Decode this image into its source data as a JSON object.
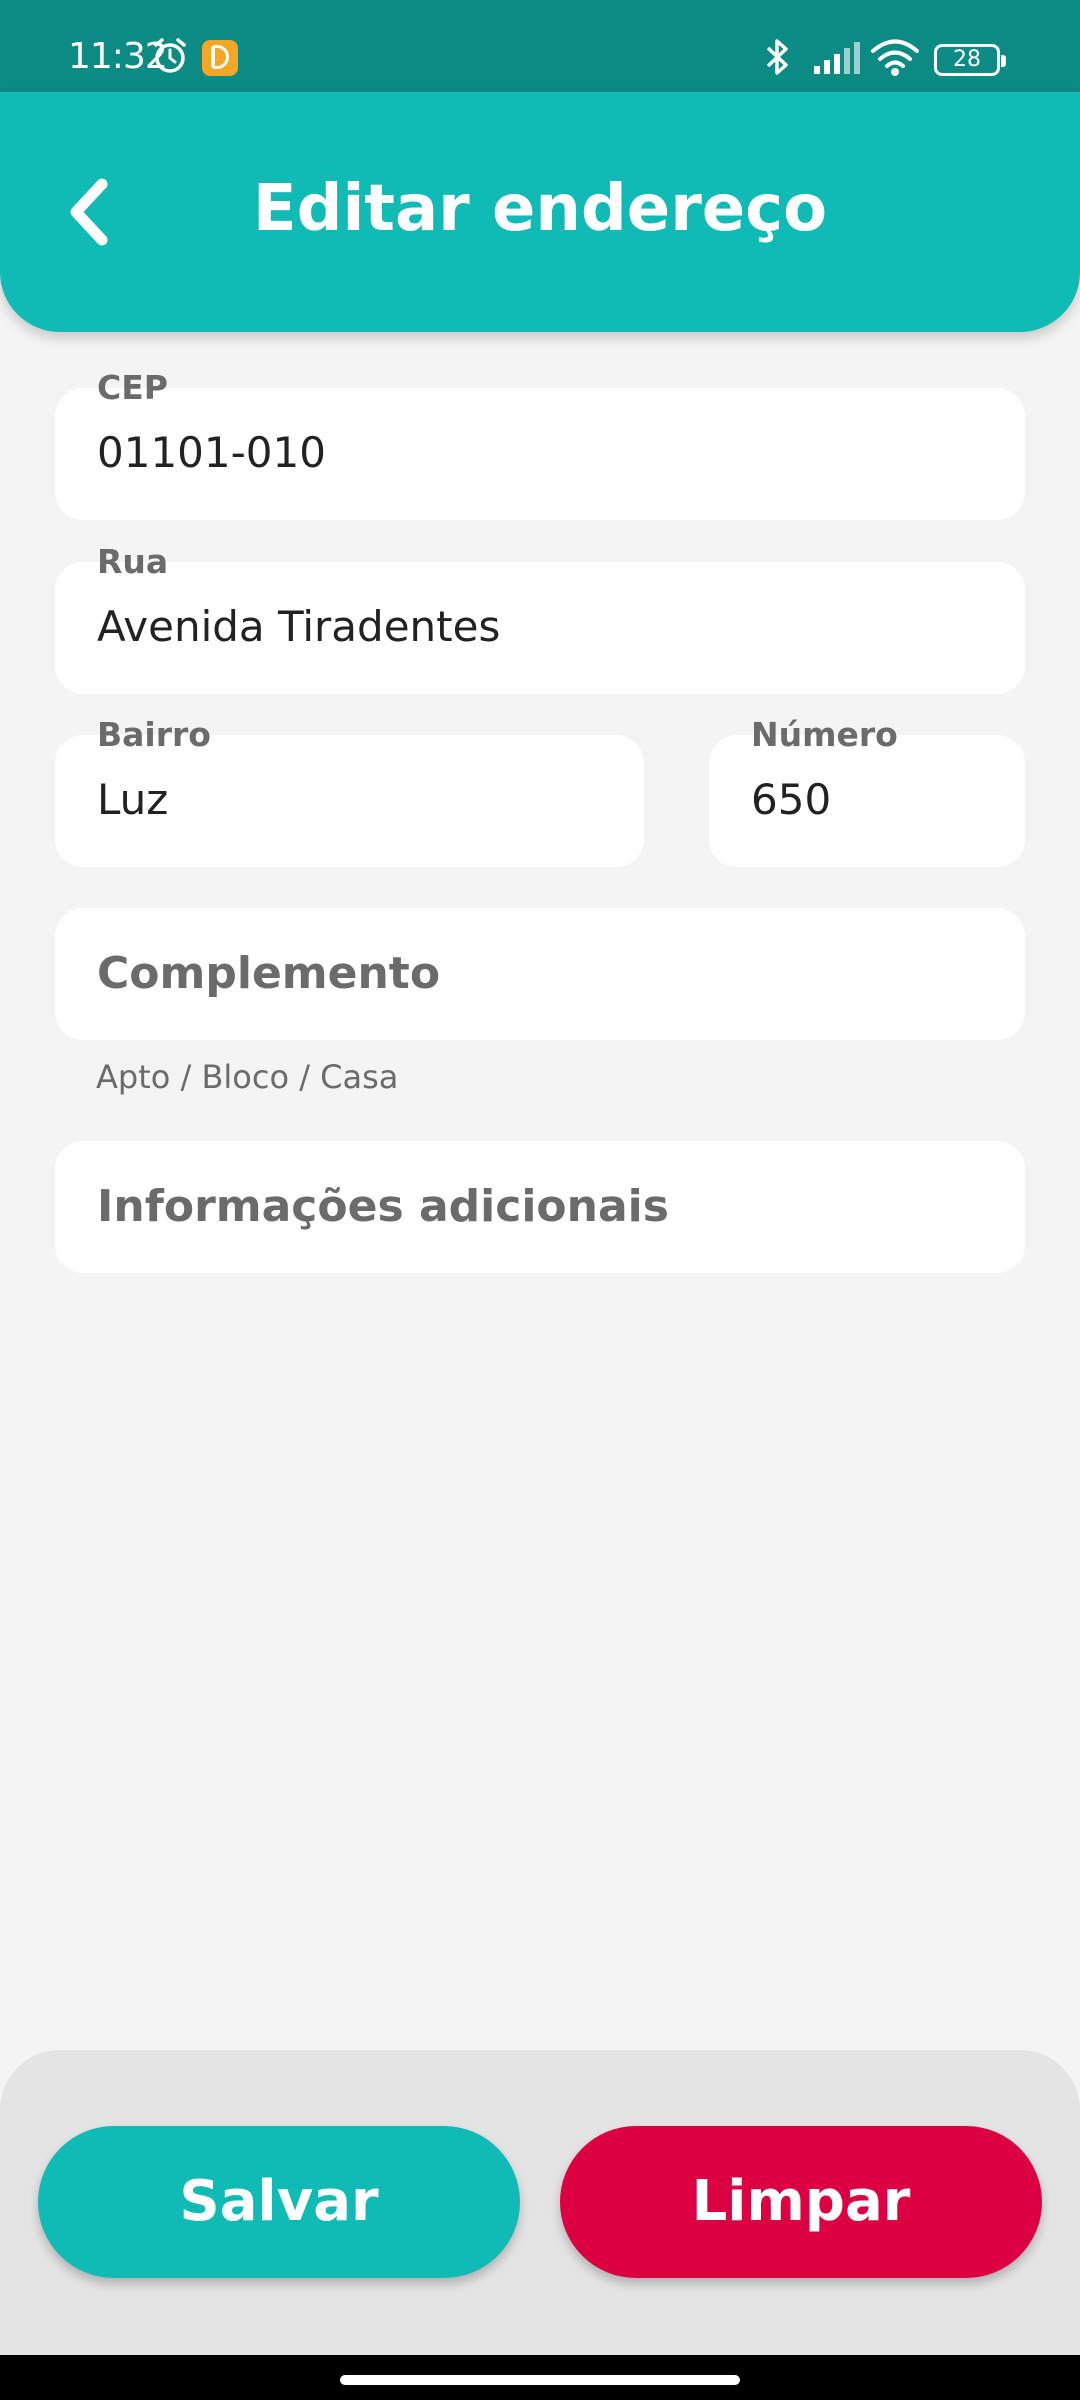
{
  "status_bar": {
    "time": "11:32",
    "battery": "28",
    "icons": [
      "alarm-icon",
      "app-notification-icon",
      "bluetooth-icon",
      "signal-icon",
      "wifi-icon",
      "battery-icon"
    ]
  },
  "header": {
    "title": "Editar endereço",
    "back_icon": "chevron-left-icon"
  },
  "form": {
    "cep": {
      "label": "CEP",
      "value": "01101-010"
    },
    "rua": {
      "label": "Rua",
      "value": "Avenida Tiradentes"
    },
    "bairro": {
      "label": "Bairro",
      "value": "Luz"
    },
    "numero": {
      "label": "Número",
      "value": "650"
    },
    "complemento": {
      "placeholder": "Complemento",
      "helper": "Apto / Bloco / Casa"
    },
    "info": {
      "placeholder": "Informações adicionais"
    }
  },
  "actions": {
    "save_label": "Salvar",
    "clear_label": "Limpar"
  },
  "colors": {
    "status_bar": "#0c8a84",
    "header": "#0fbbb4",
    "save_button": "#0fbbb4",
    "clear_button": "#dc0043",
    "background": "#f4f4f4"
  }
}
